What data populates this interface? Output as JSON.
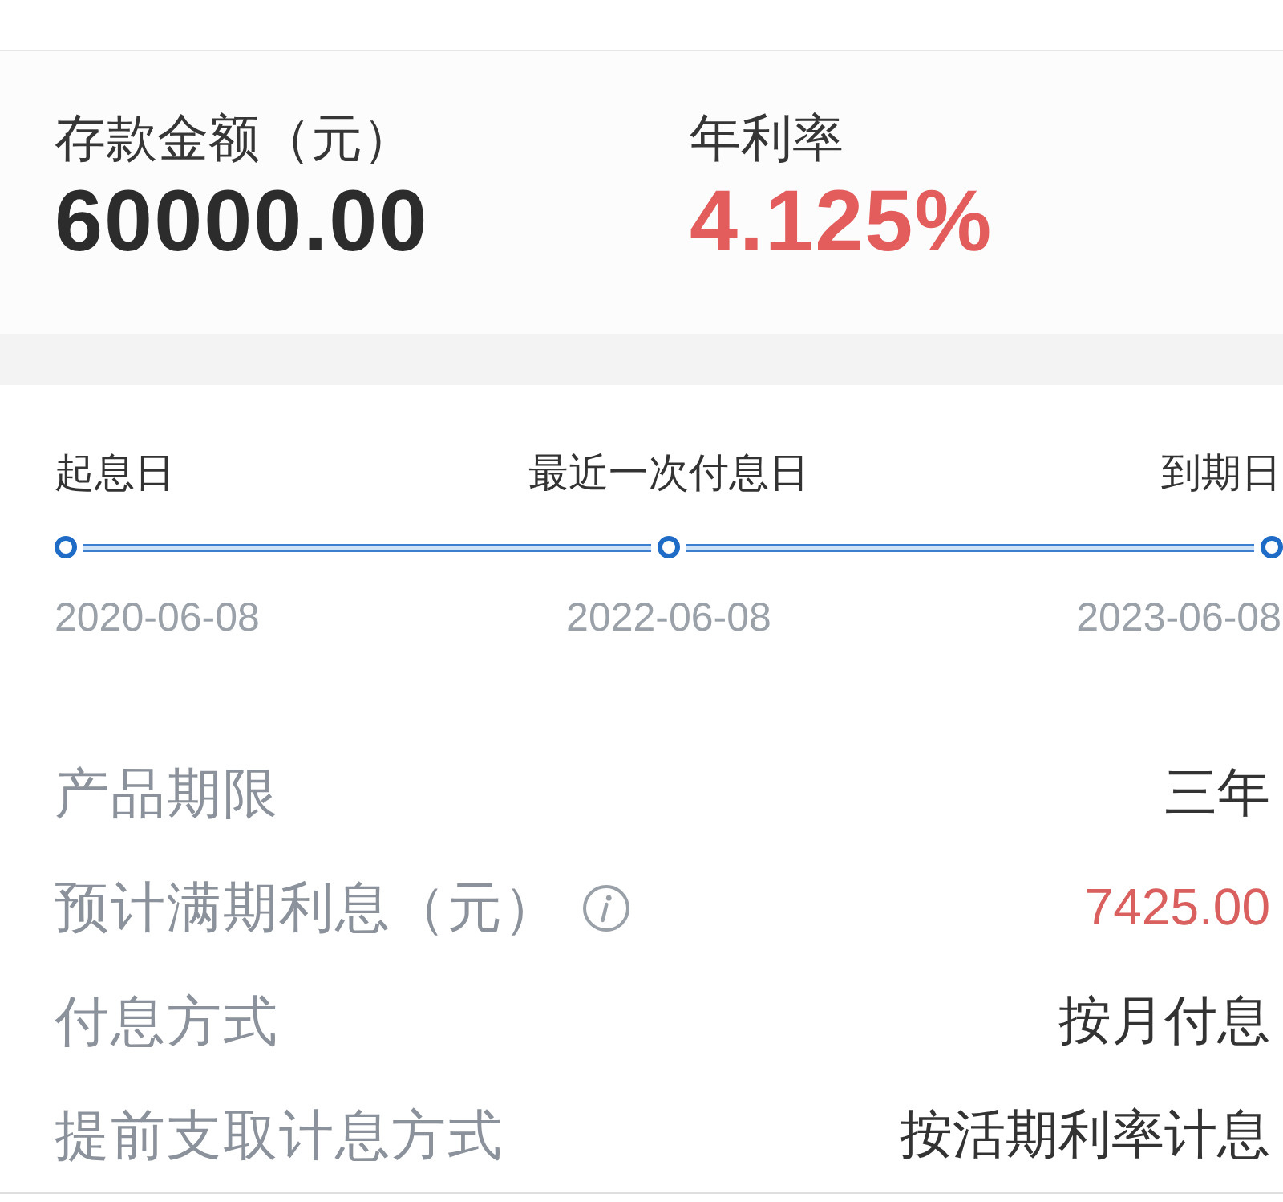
{
  "deposit": {
    "amount_label": "存款金额（元）",
    "amount": "60000.00",
    "rate_label": "年利率",
    "rate": "4.125%"
  },
  "timeline": {
    "points": [
      {
        "label": "起息日",
        "date": "2020-06-08"
      },
      {
        "label": "最近一次付息日",
        "date": "2022-06-08"
      },
      {
        "label": "到期日",
        "date": "2023-06-08"
      }
    ]
  },
  "details": [
    {
      "label": "产品期限",
      "value": "三年",
      "kind": "text"
    },
    {
      "label": "预计满期利息（元）",
      "value": "7425.00",
      "kind": "amount",
      "info": true
    },
    {
      "label": "付息方式",
      "value": "按月付息",
      "kind": "text"
    },
    {
      "label": "提前支取计息方式",
      "value": "按活期利率计息",
      "kind": "text"
    }
  ]
}
